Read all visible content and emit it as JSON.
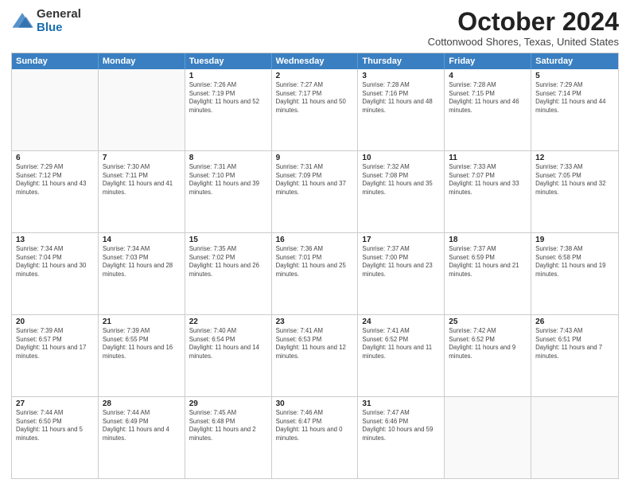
{
  "header": {
    "logo": {
      "line1": "General",
      "line2": "Blue"
    },
    "title": "October 2024",
    "subtitle": "Cottonwood Shores, Texas, United States"
  },
  "calendar": {
    "days_of_week": [
      "Sunday",
      "Monday",
      "Tuesday",
      "Wednesday",
      "Thursday",
      "Friday",
      "Saturday"
    ],
    "rows": [
      [
        {
          "day": "",
          "empty": true
        },
        {
          "day": "",
          "empty": true
        },
        {
          "day": "1",
          "sunrise": "7:26 AM",
          "sunset": "7:19 PM",
          "daylight": "11 hours and 52 minutes."
        },
        {
          "day": "2",
          "sunrise": "7:27 AM",
          "sunset": "7:17 PM",
          "daylight": "11 hours and 50 minutes."
        },
        {
          "day": "3",
          "sunrise": "7:28 AM",
          "sunset": "7:16 PM",
          "daylight": "11 hours and 48 minutes."
        },
        {
          "day": "4",
          "sunrise": "7:28 AM",
          "sunset": "7:15 PM",
          "daylight": "11 hours and 46 minutes."
        },
        {
          "day": "5",
          "sunrise": "7:29 AM",
          "sunset": "7:14 PM",
          "daylight": "11 hours and 44 minutes."
        }
      ],
      [
        {
          "day": "6",
          "sunrise": "7:29 AM",
          "sunset": "7:12 PM",
          "daylight": "11 hours and 43 minutes."
        },
        {
          "day": "7",
          "sunrise": "7:30 AM",
          "sunset": "7:11 PM",
          "daylight": "11 hours and 41 minutes."
        },
        {
          "day": "8",
          "sunrise": "7:31 AM",
          "sunset": "7:10 PM",
          "daylight": "11 hours and 39 minutes."
        },
        {
          "day": "9",
          "sunrise": "7:31 AM",
          "sunset": "7:09 PM",
          "daylight": "11 hours and 37 minutes."
        },
        {
          "day": "10",
          "sunrise": "7:32 AM",
          "sunset": "7:08 PM",
          "daylight": "11 hours and 35 minutes."
        },
        {
          "day": "11",
          "sunrise": "7:33 AM",
          "sunset": "7:07 PM",
          "daylight": "11 hours and 33 minutes."
        },
        {
          "day": "12",
          "sunrise": "7:33 AM",
          "sunset": "7:05 PM",
          "daylight": "11 hours and 32 minutes."
        }
      ],
      [
        {
          "day": "13",
          "sunrise": "7:34 AM",
          "sunset": "7:04 PM",
          "daylight": "11 hours and 30 minutes."
        },
        {
          "day": "14",
          "sunrise": "7:34 AM",
          "sunset": "7:03 PM",
          "daylight": "11 hours and 28 minutes."
        },
        {
          "day": "15",
          "sunrise": "7:35 AM",
          "sunset": "7:02 PM",
          "daylight": "11 hours and 26 minutes."
        },
        {
          "day": "16",
          "sunrise": "7:36 AM",
          "sunset": "7:01 PM",
          "daylight": "11 hours and 25 minutes."
        },
        {
          "day": "17",
          "sunrise": "7:37 AM",
          "sunset": "7:00 PM",
          "daylight": "11 hours and 23 minutes."
        },
        {
          "day": "18",
          "sunrise": "7:37 AM",
          "sunset": "6:59 PM",
          "daylight": "11 hours and 21 minutes."
        },
        {
          "day": "19",
          "sunrise": "7:38 AM",
          "sunset": "6:58 PM",
          "daylight": "11 hours and 19 minutes."
        }
      ],
      [
        {
          "day": "20",
          "sunrise": "7:39 AM",
          "sunset": "6:57 PM",
          "daylight": "11 hours and 17 minutes."
        },
        {
          "day": "21",
          "sunrise": "7:39 AM",
          "sunset": "6:55 PM",
          "daylight": "11 hours and 16 minutes."
        },
        {
          "day": "22",
          "sunrise": "7:40 AM",
          "sunset": "6:54 PM",
          "daylight": "11 hours and 14 minutes."
        },
        {
          "day": "23",
          "sunrise": "7:41 AM",
          "sunset": "6:53 PM",
          "daylight": "11 hours and 12 minutes."
        },
        {
          "day": "24",
          "sunrise": "7:41 AM",
          "sunset": "6:52 PM",
          "daylight": "11 hours and 11 minutes."
        },
        {
          "day": "25",
          "sunrise": "7:42 AM",
          "sunset": "6:52 PM",
          "daylight": "11 hours and 9 minutes."
        },
        {
          "day": "26",
          "sunrise": "7:43 AM",
          "sunset": "6:51 PM",
          "daylight": "11 hours and 7 minutes."
        }
      ],
      [
        {
          "day": "27",
          "sunrise": "7:44 AM",
          "sunset": "6:50 PM",
          "daylight": "11 hours and 5 minutes."
        },
        {
          "day": "28",
          "sunrise": "7:44 AM",
          "sunset": "6:49 PM",
          "daylight": "11 hours and 4 minutes."
        },
        {
          "day": "29",
          "sunrise": "7:45 AM",
          "sunset": "6:48 PM",
          "daylight": "11 hours and 2 minutes."
        },
        {
          "day": "30",
          "sunrise": "7:46 AM",
          "sunset": "6:47 PM",
          "daylight": "11 hours and 0 minutes."
        },
        {
          "day": "31",
          "sunrise": "7:47 AM",
          "sunset": "6:46 PM",
          "daylight": "10 hours and 59 minutes."
        },
        {
          "day": "",
          "empty": true
        },
        {
          "day": "",
          "empty": true
        }
      ]
    ]
  }
}
